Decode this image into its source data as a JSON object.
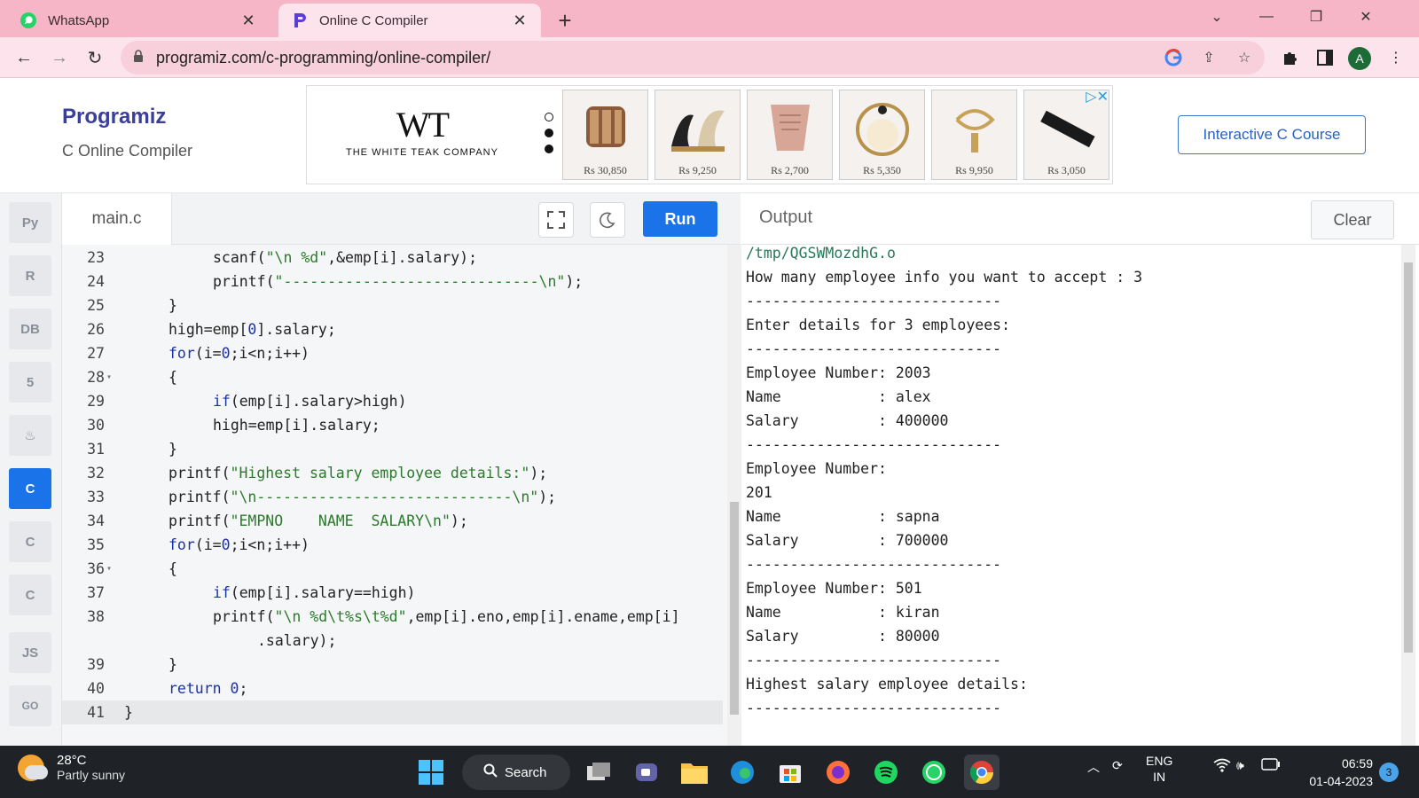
{
  "browser": {
    "tabs": [
      {
        "title": "WhatsApp",
        "icon": "whatsapp-icon"
      },
      {
        "title": "Online C Compiler",
        "icon": "programiz-icon"
      }
    ],
    "url": "programiz.com/c-programming/online-compiler/",
    "profile_initial": "A"
  },
  "header": {
    "brand": "Programiz",
    "subtitle": "C Online Compiler",
    "course_button": "Interactive C Course"
  },
  "ad": {
    "logo": "WT",
    "company": "THE WHITE TEAK COMPANY",
    "prices": [
      "Rs 30,850",
      "Rs 9,250",
      "Rs 2,700",
      "Rs 5,350",
      "Rs 9,950",
      "Rs 3,050"
    ]
  },
  "sidebar": {
    "languages": [
      {
        "name": "python",
        "glyph": "Py"
      },
      {
        "name": "r",
        "glyph": "R"
      },
      {
        "name": "sql",
        "glyph": "DB"
      },
      {
        "name": "html",
        "glyph": "5"
      },
      {
        "name": "java",
        "glyph": "♨"
      },
      {
        "name": "c",
        "glyph": "C"
      },
      {
        "name": "cpp",
        "glyph": "C"
      },
      {
        "name": "csharp",
        "glyph": "C"
      },
      {
        "name": "javascript",
        "glyph": "JS"
      },
      {
        "name": "go",
        "glyph": "GO"
      }
    ]
  },
  "editor": {
    "filename": "main.c",
    "run_label": "Run",
    "lines": [
      {
        "n": "23",
        "indent": 2,
        "html": "scanf(<span class='str'>\"\\n %d\"</span>,&amp;emp[i].salary);"
      },
      {
        "n": "24",
        "indent": 2,
        "html": "printf(<span class='str'>\"-----------------------------\\n\"</span>);"
      },
      {
        "n": "25",
        "indent": 1,
        "html": "}"
      },
      {
        "n": "26",
        "indent": 1,
        "html": "high=emp[<span class='num'>0</span>].salary;"
      },
      {
        "n": "27",
        "indent": 1,
        "html": "<span class='kw'>for</span>(i=<span class='num'>0</span>;i&lt;n;i++)"
      },
      {
        "n": "28",
        "indent": 1,
        "fold": true,
        "html": "{"
      },
      {
        "n": "29",
        "indent": 2,
        "html": "<span class='kw'>if</span>(emp[i].salary&gt;high)"
      },
      {
        "n": "30",
        "indent": 2,
        "html": "high=emp[i].salary;"
      },
      {
        "n": "31",
        "indent": 1,
        "html": "}"
      },
      {
        "n": "32",
        "indent": 1,
        "html": "printf(<span class='str'>\"Highest salary employee details:\"</span>);"
      },
      {
        "n": "33",
        "indent": 1,
        "html": "printf(<span class='str'>\"\\n-----------------------------\\n\"</span>);"
      },
      {
        "n": "34",
        "indent": 1,
        "html": "printf(<span class='str'>\"EMPNO    NAME  SALARY\\n\"</span>);"
      },
      {
        "n": "35",
        "indent": 1,
        "html": "<span class='kw'>for</span>(i=<span class='num'>0</span>;i&lt;n;i++)"
      },
      {
        "n": "36",
        "indent": 1,
        "fold": true,
        "html": "{"
      },
      {
        "n": "37",
        "indent": 2,
        "html": "<span class='kw'>if</span>(emp[i].salary==high)"
      },
      {
        "n": "38",
        "indent": 2,
        "html": "printf(<span class='str'>\"\\n %d\\t%s\\t%d\"</span>,emp[i].eno,emp[i].ename,emp[i]"
      },
      {
        "n": "",
        "indent": 3,
        "html": ".salary);"
      },
      {
        "n": "39",
        "indent": 1,
        "html": "}"
      },
      {
        "n": "40",
        "indent": 1,
        "html": "<span class='kw'>return</span> <span class='num'>0</span>;"
      },
      {
        "n": "41",
        "indent": 0,
        "current": true,
        "html": "}"
      }
    ]
  },
  "output": {
    "title": "Output",
    "clear_label": "Clear",
    "lines": [
      "/tmp/QGSWMozdhG.o",
      "How many employee info you want to accept : 3",
      "-----------------------------",
      "Enter details for 3 employees:",
      "-----------------------------",
      "Employee Number: 2003",
      "Name           : alex",
      "Salary         : 400000",
      "-----------------------------",
      "Employee Number:",
      "201",
      "Name           : sapna",
      "Salary         : 700000",
      "-----------------------------",
      "Employee Number: 501",
      "Name           : kiran",
      "Salary         : 80000",
      "-----------------------------",
      "Highest salary employee details:",
      "-----------------------------"
    ]
  },
  "taskbar": {
    "temperature": "28°C",
    "condition": "Partly sunny",
    "search_label": "Search",
    "lang_top": "ENG",
    "lang_bottom": "IN",
    "time": "06:59",
    "date": "01-04-2023",
    "notifications": "3"
  }
}
